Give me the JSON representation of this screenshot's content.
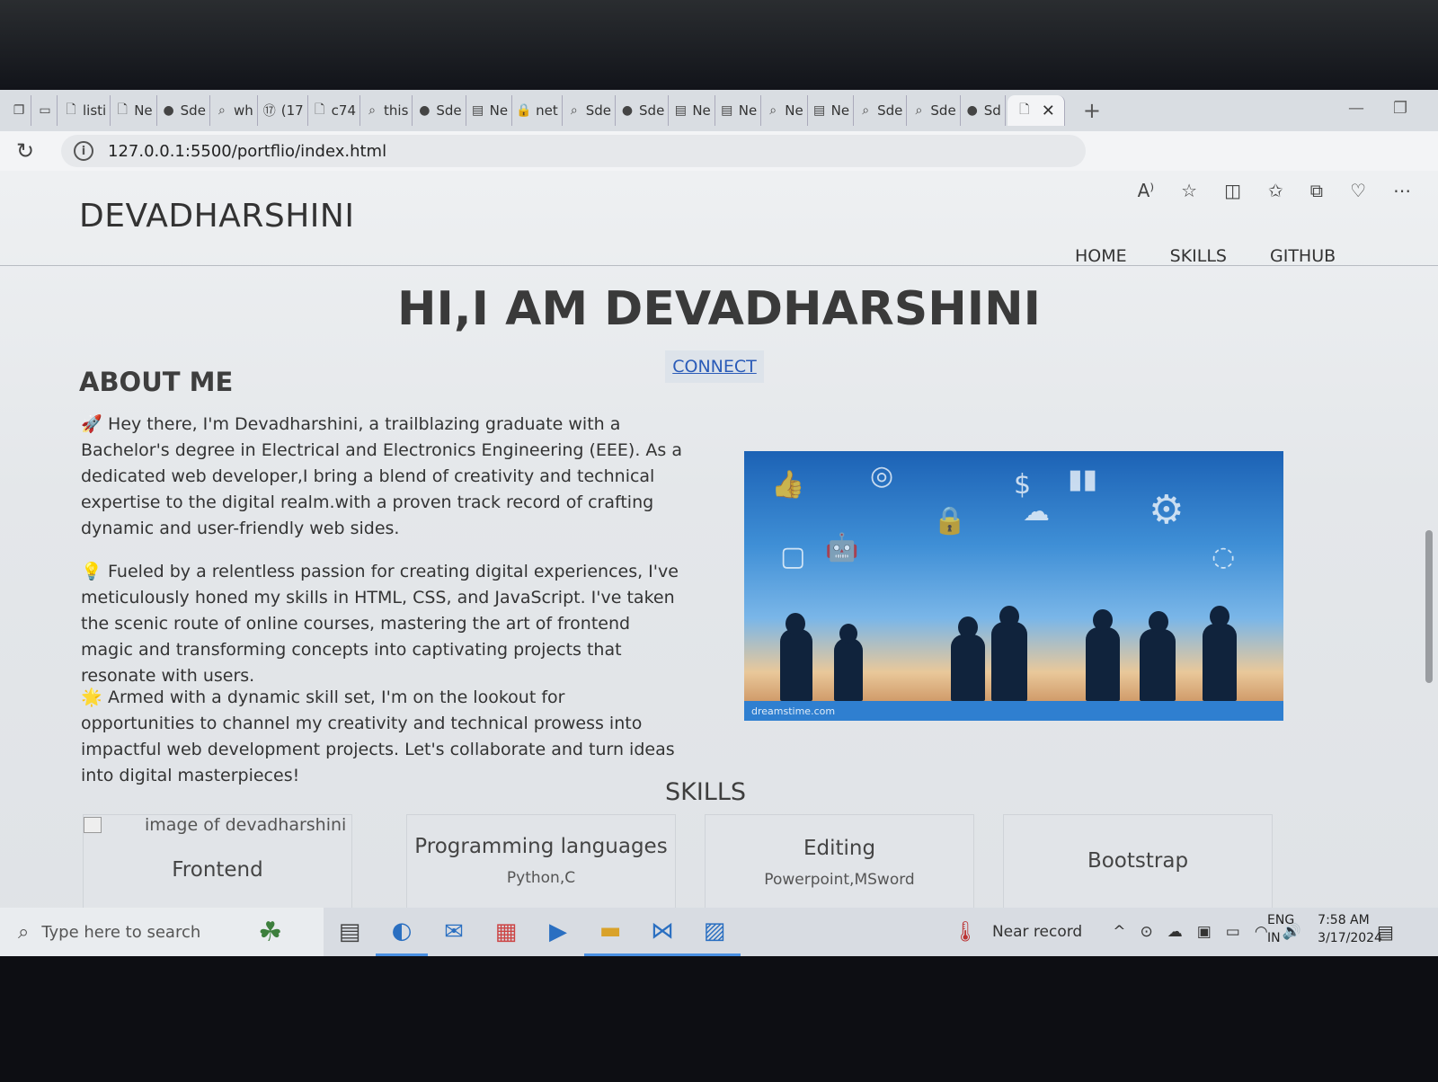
{
  "browser": {
    "tabs": [
      {
        "label": "listi",
        "icon": "page-icon"
      },
      {
        "label": "Ne",
        "icon": "page-icon"
      },
      {
        "label": "Sde",
        "icon": "github-icon"
      },
      {
        "label": "wh",
        "icon": "search-icon"
      },
      {
        "label": "(17",
        "icon": "badge-icon",
        "badge": "17"
      },
      {
        "label": "c74",
        "icon": "page-icon"
      },
      {
        "label": "this",
        "icon": "search-icon"
      },
      {
        "label": "Sde",
        "icon": "github-icon"
      },
      {
        "label": "Ne",
        "icon": "form-icon"
      },
      {
        "label": "net",
        "icon": "lock-icon"
      },
      {
        "label": "Sde",
        "icon": "search-icon"
      },
      {
        "label": "Sde",
        "icon": "github-icon"
      },
      {
        "label": "Ne",
        "icon": "form-icon"
      },
      {
        "label": "Ne",
        "icon": "form-icon"
      },
      {
        "label": "Ne",
        "icon": "search-icon"
      },
      {
        "label": "Ne",
        "icon": "form-icon"
      },
      {
        "label": "Sde",
        "icon": "search-icon"
      },
      {
        "label": "Sde",
        "icon": "search-icon"
      },
      {
        "label": "Sd",
        "icon": "github-icon"
      }
    ],
    "url": "127.0.0.1:5500/portflio/index.html",
    "close_glyph": "✕",
    "new_tab_glyph": "+"
  },
  "site": {
    "brand": "DEVADHARSHINI",
    "nav": [
      "HOME",
      "SKILLS",
      "GITHUB"
    ],
    "hero_title": "HI,I AM DEVADHARSHINI",
    "connect": "CONNECT",
    "about_title": "ABOUT ME",
    "about_paragraphs": [
      {
        "emoji": "🚀",
        "text": "Hey there, I'm Devadharshini, a trailblazing graduate with a Bachelor's degree in Electrical and Electronics Engineering (EEE). As a dedicated web developer,I bring a blend of creativity and technical expertise to the digital realm.with a proven track record of crafting dynamic and user-friendly web sides."
      },
      {
        "emoji": "💡",
        "text": "Fueled by a relentless passion for creating digital experiences, I've meticulously honed my skills in HTML, CSS, and JavaScript. I've taken the scenic route of online courses, mastering the art of frontend magic and transforming concepts into captivating projects that resonate with users."
      },
      {
        "emoji": "🌟",
        "text": "Armed with a dynamic skill set, I'm on the lookout for opportunities to channel my creativity and technical prowess into impactful web development projects. Let's collaborate and turn ideas into digital masterpieces!"
      }
    ],
    "image_watermark": "dreamstime.com",
    "skills_title": "SKILLS",
    "profile_image_alt": "image of devadharshini",
    "skill_cards": [
      {
        "name": "Frontend",
        "detail": ""
      },
      {
        "name": "Programming languages",
        "detail": "Python,C"
      },
      {
        "name": "Editing",
        "detail": "Powerpoint,MSword"
      },
      {
        "name": "Bootstrap",
        "detail": ""
      }
    ]
  },
  "taskbar": {
    "search_placeholder": "Type here to search",
    "weather": "Near record",
    "lang_top": "ENG",
    "lang_bottom": "IN",
    "time": "7:58 AM",
    "date": "3/17/2024"
  }
}
